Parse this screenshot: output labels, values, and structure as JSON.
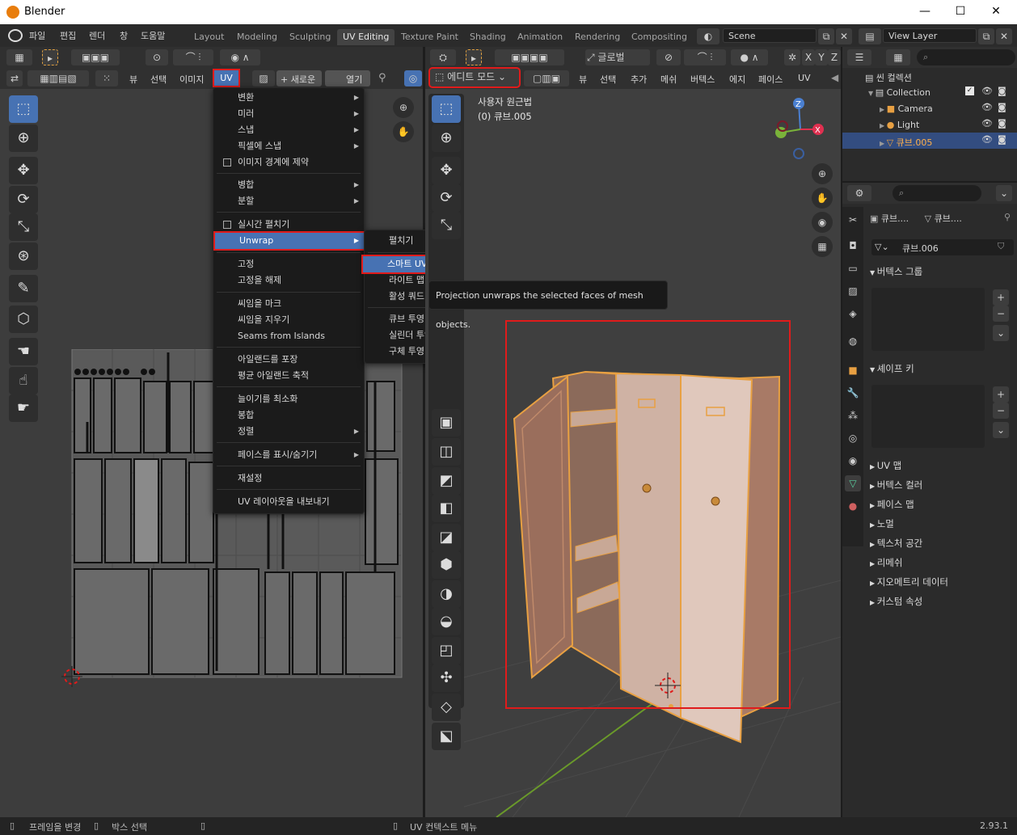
{
  "window": {
    "title": "Blender",
    "minimize": "—",
    "maximize": "☐",
    "close": "✕"
  },
  "menubar": {
    "items": [
      "파일",
      "편집",
      "렌더",
      "창",
      "도움말"
    ]
  },
  "workspaces": [
    "Layout",
    "Modeling",
    "Sculpting",
    "UV Editing",
    "Texture Paint",
    "Shading",
    "Animation",
    "Rendering",
    "Compositing"
  ],
  "active_workspace": "UV Editing",
  "scene": {
    "label": "Scene",
    "view_layer": "View Layer"
  },
  "uv_editor": {
    "header_menus": {
      "view": "뷰",
      "select": "선택",
      "image": "이미지",
      "uv": "UV"
    },
    "new_button": "+ 새로운",
    "open_button": "열기"
  },
  "uv_menu": {
    "items": [
      {
        "label": "변환",
        "submenu": true
      },
      {
        "label": "미러",
        "submenu": true
      },
      {
        "label": "스냅",
        "submenu": true
      },
      {
        "label": "픽셀에 스냅",
        "submenu": true
      },
      {
        "label": "이미지 경계에 제약",
        "checkbox": true
      },
      {
        "label": "병합",
        "submenu": true
      },
      {
        "label": "분할",
        "submenu": true
      },
      {
        "label": "실시간 펼치기",
        "checkbox": true
      },
      {
        "label": "Unwrap",
        "submenu": true,
        "selected": true
      },
      {
        "label": "고정"
      },
      {
        "label": "고정을 해제"
      },
      {
        "label": "씨임을 마크"
      },
      {
        "label": "씨임을 지우기"
      },
      {
        "label": "Seams from Islands"
      },
      {
        "label": "아일랜드를 포장"
      },
      {
        "label": "평균 아일랜드 축적"
      },
      {
        "label": "늘이기를 최소화"
      },
      {
        "label": "봉합"
      },
      {
        "label": "정렬",
        "submenu": true
      },
      {
        "label": "페이스를 표시/숨기기",
        "submenu": true
      },
      {
        "label": "재설정"
      },
      {
        "label": "UV 레이아웃을 내보내기"
      }
    ]
  },
  "unwrap_submenu": {
    "items": [
      "펼치기",
      "스마트 UV 투사",
      "라이트 맵 팩",
      "활성 쿼드",
      "큐브 투영",
      "실린더 투영",
      "구체 투영"
    ],
    "selected": "스마트 UV 투사"
  },
  "tooltip": "Projection unwraps the selected faces of mesh objects.",
  "viewport": {
    "mode": "에디트 모드",
    "header_menus": [
      "뷰",
      "선택",
      "추가",
      "메쉬",
      "버텍스",
      "에지",
      "페이스",
      "UV"
    ],
    "orientation": "글로벌",
    "view_name": "사용자 원근법",
    "object_name": "(0) 큐브.005",
    "axes": [
      "X",
      "Y",
      "Z"
    ]
  },
  "outliner": {
    "scene_collection": "씬 컬렉션",
    "collection": "Collection",
    "objects": [
      {
        "name": "Camera",
        "selected": false
      },
      {
        "name": "Light",
        "selected": false
      },
      {
        "name": "큐브.005",
        "selected": true
      }
    ]
  },
  "properties": {
    "object_name": "큐브....",
    "mesh_name": "큐브....",
    "data_name": "큐브.006",
    "panels_open": [
      "버텍스 그룹",
      "셰이프 키"
    ],
    "panels_closed": [
      "UV 맵",
      "버텍스 컬러",
      "페이스 맵",
      "노멀",
      "텍스처 공간",
      "리메쉬",
      "지오메트리 데이터",
      "커스텀 속성"
    ]
  },
  "statusbar": {
    "left1": "프레임을 변경",
    "left2": "박스 선택",
    "center": "UV 컨텍스트 메뉴",
    "version": "2.93.1"
  },
  "colors": {
    "accent": "#4772b3",
    "highlight": "#e01b1b",
    "mesh_orange": "#e8a042"
  }
}
